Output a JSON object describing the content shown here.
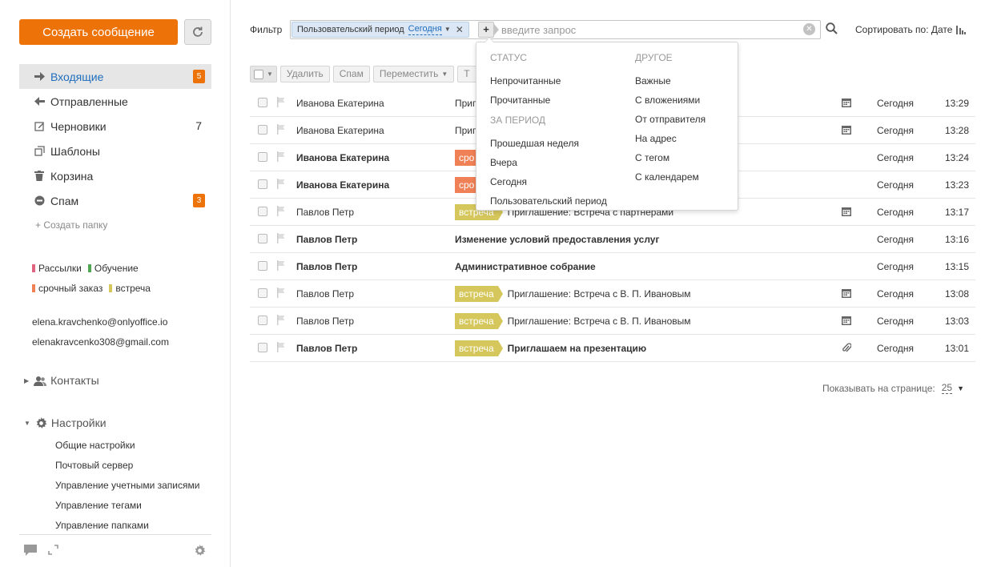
{
  "sidebar": {
    "compose_label": "Создать сообщение",
    "folders": [
      {
        "label": "Входящие",
        "count": "5"
      },
      {
        "label": "Отправленные",
        "count": ""
      },
      {
        "label": "Черновики",
        "count": "7"
      },
      {
        "label": "Шаблоны",
        "count": ""
      },
      {
        "label": "Корзина",
        "count": ""
      },
      {
        "label": "Спам",
        "count": "3"
      }
    ],
    "create_folder_label": "+ Создать папку",
    "tags": [
      {
        "label": "Рассылки",
        "color": "#e0647f"
      },
      {
        "label": "Обучение",
        "color": "#4fa84f"
      },
      {
        "label": "срочный заказ",
        "color": "#f08157"
      },
      {
        "label": "встреча",
        "color": "#d5c75b"
      }
    ],
    "accounts": [
      "elena.kravchenko@onlyoffice.io",
      "elenakravcenko308@gmail.com"
    ],
    "contacts_label": "Контакты",
    "settings_label": "Настройки",
    "settings_items": [
      "Общие настройки",
      "Почтовый сервер",
      "Управление учетными записями",
      "Управление тегами",
      "Управление папками"
    ]
  },
  "filter": {
    "label": "Фильтр",
    "chip_label": "Пользовательский период",
    "chip_value": "Сегодня",
    "placeholder": "введите запрос",
    "sort_label": "Сортировать по: Дате"
  },
  "toolbar": {
    "delete": "Удалить",
    "spam": "Спам",
    "move": "Переместить",
    "more": "Т"
  },
  "mails": [
    {
      "from": "Иванова Екатерина",
      "tag": "",
      "subject": "Приг",
      "icon": "calendar",
      "date": "Сегодня",
      "time": "13:29",
      "unread": false
    },
    {
      "from": "Иванова Екатерина",
      "tag": "",
      "subject": "Приг",
      "icon": "calendar",
      "date": "Сегодня",
      "time": "13:28",
      "unread": false
    },
    {
      "from": "Иванова Екатерина",
      "tag": "сро",
      "tag_color": "#f08157",
      "subject": "",
      "icon": "",
      "date": "Сегодня",
      "time": "13:24",
      "unread": true
    },
    {
      "from": "Иванова Екатерина",
      "tag": "сро",
      "tag_color": "#f08157",
      "subject": "",
      "icon": "",
      "date": "Сегодня",
      "time": "13:23",
      "unread": true
    },
    {
      "from": "Павлов Петр",
      "tag": "встреча",
      "tag_color": "#d5c75b",
      "subject": "Приглашение: Встреча с партнерами",
      "icon": "calendar",
      "date": "Сегодня",
      "time": "13:17",
      "unread": false
    },
    {
      "from": "Павлов Петр",
      "tag": "",
      "subject": "Изменение условий предоставления услуг",
      "icon": "",
      "date": "Сегодня",
      "time": "13:16",
      "unread": true
    },
    {
      "from": "Павлов Петр",
      "tag": "",
      "subject": "Административное собрание",
      "icon": "",
      "date": "Сегодня",
      "time": "13:15",
      "unread": true
    },
    {
      "from": "Павлов Петр",
      "tag": "встреча",
      "tag_color": "#d5c75b",
      "subject": "Приглашение: Встреча с В. П. Ивановым",
      "icon": "calendar",
      "date": "Сегодня",
      "time": "13:08",
      "unread": false
    },
    {
      "from": "Павлов Петр",
      "tag": "встреча",
      "tag_color": "#d5c75b",
      "subject": "Приглашение: Встреча с В. П. Ивановым",
      "icon": "calendar",
      "date": "Сегодня",
      "time": "13:03",
      "unread": false
    },
    {
      "from": "Павлов Петр",
      "tag": "встреча",
      "tag_color": "#d5c75b",
      "subject": "Приглашаем на презентацию",
      "icon": "paperclip",
      "date": "Сегодня",
      "time": "13:01",
      "unread": true
    }
  ],
  "pager": {
    "label": "Показывать на странице:",
    "value": "25"
  },
  "dropdown": {
    "status_header": "СТАТУС",
    "status_items": [
      "Непрочитанные",
      "Прочитанные"
    ],
    "period_header": "ЗА ПЕРИОД",
    "period_items": [
      "Прошедшая неделя",
      "Вчера",
      "Сегодня",
      "Пользовательский период"
    ],
    "other_header": "ДРУГОЕ",
    "other_items": [
      "Важные",
      "С вложениями",
      "От отправителя",
      "На адрес",
      "С тегом",
      "С календарем"
    ]
  },
  "colors": {
    "accent": "#ed7309",
    "link": "#1f6dbe"
  }
}
